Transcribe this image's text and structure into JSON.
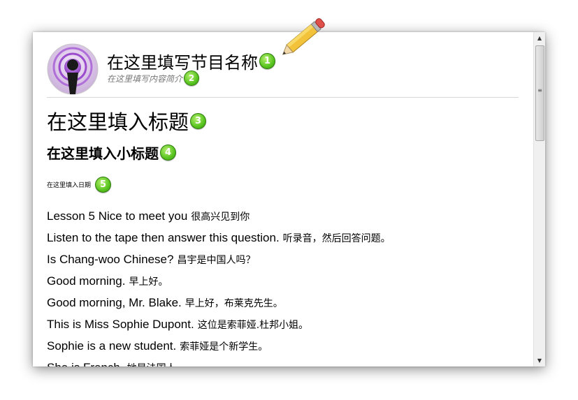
{
  "header": {
    "show_title": "在这里填写节目名称",
    "show_title_badge": "1",
    "show_desc": "在这里填写内容简介",
    "show_desc_badge": "2"
  },
  "content": {
    "title": "在这里填入标题",
    "title_badge": "3",
    "subtitle": "在这里填入小标题",
    "subtitle_badge": "4",
    "date": "在这里填入日期",
    "date_badge": "5",
    "lines": [
      {
        "en": "Lesson 5 Nice to meet you",
        "cn": "很高兴见到你"
      },
      {
        "en": "Listen to the tape then answer this question.",
        "cn": "听录音，然后回答问题。"
      },
      {
        "en": "Is Chang-woo Chinese?",
        "cn": "昌宇是中国人吗？"
      },
      {
        "en": "Good morning.",
        "cn": "早上好。"
      },
      {
        "en": "Good morning, Mr. Blake.",
        "cn": "早上好，布莱克先生。"
      },
      {
        "en": "This is Miss Sophie Dupont.",
        "cn": "这位是索菲娅.杜邦小姐。"
      },
      {
        "en": "Sophie is a new student.",
        "cn": "索菲娅是个新学生。"
      },
      {
        "en": "She is French.",
        "cn": "她是法国人。"
      }
    ]
  },
  "icons": {
    "podcast": "podcast-icon",
    "pencil": "pencil-icon",
    "scroll_up": "scroll-up-arrow-icon",
    "scroll_down": "scroll-down-arrow-icon"
  },
  "colors": {
    "badge_green": "#58c41f",
    "description_gray": "#777777"
  }
}
